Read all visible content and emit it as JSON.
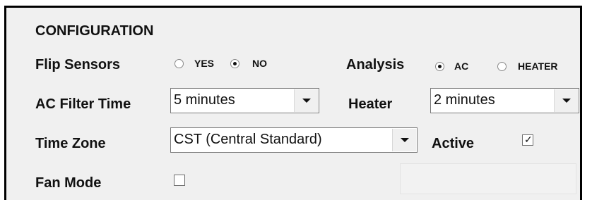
{
  "config": {
    "title": "CONFIGURATION",
    "flip_sensors": {
      "label": "Flip Sensors",
      "options": [
        "YES",
        "NO"
      ],
      "selected": "NO"
    },
    "analysis": {
      "label": "Analysis",
      "options": [
        "AC",
        "HEATER"
      ],
      "selected": "AC"
    },
    "ac_filter_time": {
      "label": "AC Filter Time",
      "value": "5 minutes"
    },
    "heater": {
      "label": "Heater",
      "value": "2 minutes"
    },
    "time_zone": {
      "label": "Time Zone",
      "value": "CST (Central Standard)"
    },
    "active": {
      "label": "Active",
      "checked": true
    },
    "fan_mode": {
      "label": "Fan Mode",
      "checked": false
    }
  }
}
